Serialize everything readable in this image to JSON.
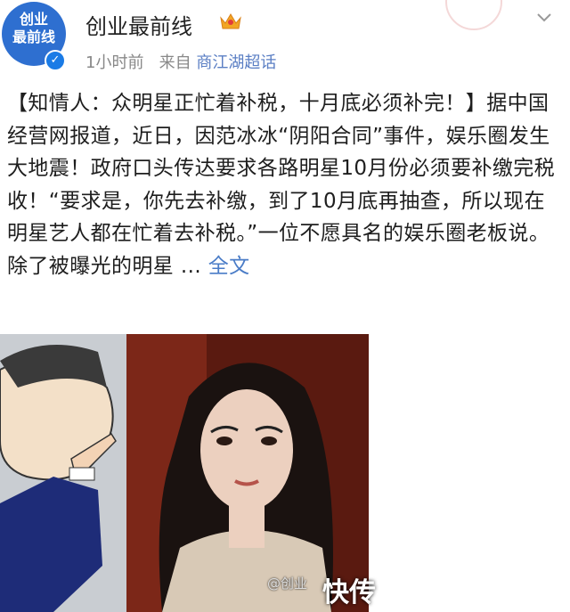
{
  "post": {
    "author": {
      "name": "创业最前线",
      "avatar_text": "创业\n最前线",
      "verified_icon": "verified-badge-icon",
      "badge_icon": "crown-icon"
    },
    "meta": {
      "time": "1小时前",
      "from_label": "来自",
      "source": "商江湖超话"
    },
    "content": {
      "text": "【知情人：众明星正忙着补税，十月底必须补完！】据中国经营网报道，近日，因范冰冰“阴阳合同”事件，娱乐圈发生大地震！政府口头传达要求各路明星10月份必须要补缴完税收！“要求是，你先去补缴，到了10月底再抽查，所以现在明星艺人都在忙着去补税。”一位不愿具名的娱乐圈老板说。除了被曝光的明星 ... ",
      "full_text_link": "全文"
    },
    "images": [
      {
        "name": "cartoon-pointing-hand"
      },
      {
        "name": "celebrity-portrait"
      }
    ],
    "watermark": {
      "small": "@创业",
      "large": "快传"
    }
  },
  "colors": {
    "link": "#4a7cc7",
    "avatar_bg": "#2e6fd0",
    "verified": "#1a7be6"
  }
}
